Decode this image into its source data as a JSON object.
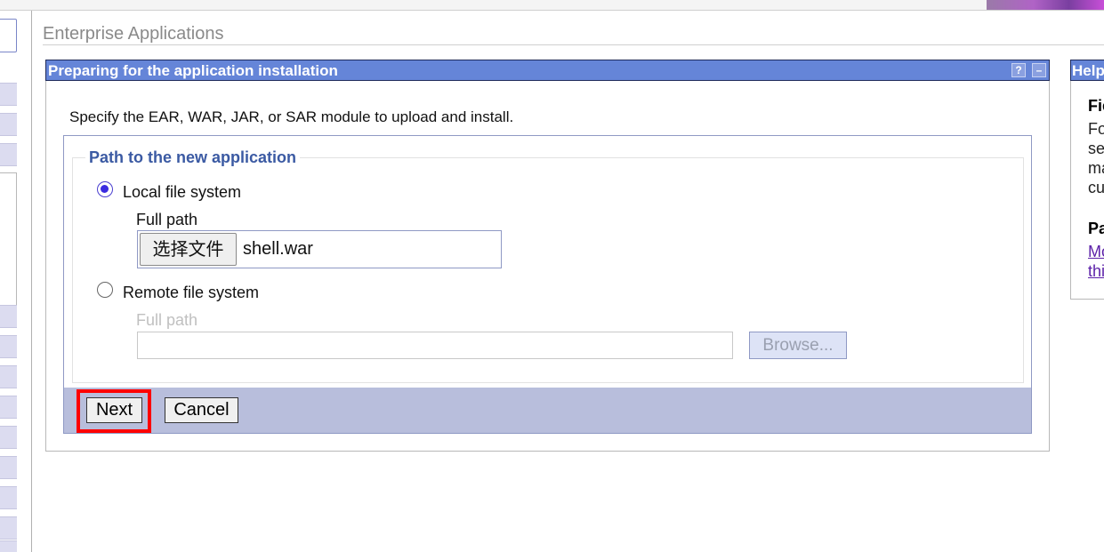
{
  "breadcrumb": "Enterprise Applications",
  "portlet": {
    "title": "Preparing for the application installation",
    "help_icon": "?",
    "minimize_icon": "–"
  },
  "form": {
    "instruction": "Specify the EAR, WAR, JAR, or SAR module to upload and install.",
    "legend": "Path to the new application",
    "local": {
      "label": "Local file system",
      "selected": true,
      "path_label": "Full path",
      "choose_file_label": "选择文件",
      "file_name": "shell.war"
    },
    "remote": {
      "label": "Remote file system",
      "selected": false,
      "path_label": "Full path",
      "path_value": "",
      "browse_label": "Browse..."
    }
  },
  "buttons": {
    "next": "Next",
    "cancel": "Cancel"
  },
  "help": {
    "title": "Help",
    "lines": [
      "Fie",
      "Fo",
      "se",
      "ma",
      "cu"
    ],
    "section": "Pa",
    "links": [
      "Mo",
      "thi"
    ]
  },
  "colors": {
    "title_bar": "#6585d8",
    "legend": "#3b5aa3",
    "button_bar": "#b8bedc",
    "highlight": "#ff0000",
    "link": "#5b1fa8"
  }
}
